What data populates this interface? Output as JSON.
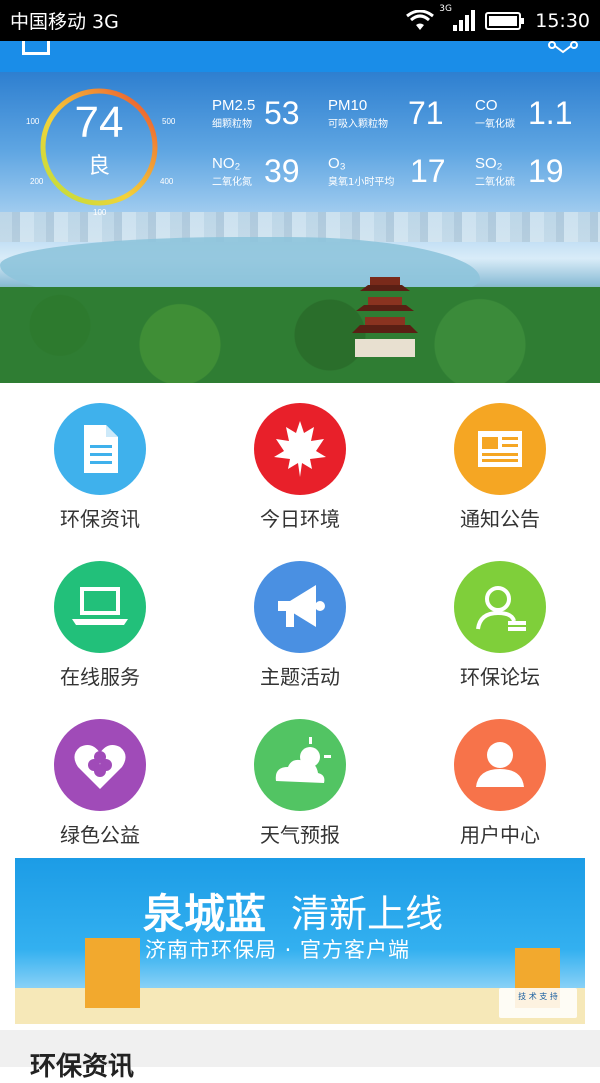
{
  "status_bar": {
    "carrier": "中国移动 3G",
    "network": "3G",
    "time": "15:30"
  },
  "air_quality": {
    "aqi": "74",
    "level": "良",
    "ring_ticks": [
      "100",
      "200",
      "300",
      "400",
      "500",
      "100"
    ],
    "pollutants": [
      {
        "name": "PM2.5",
        "desc": "细颗粒物",
        "value": "53"
      },
      {
        "name": "PM10",
        "desc": "可吸入颗粒物",
        "value": "71"
      },
      {
        "name": "CO",
        "desc": "一氧化碳",
        "value": "1.1"
      },
      {
        "name": "NO₂",
        "desc": "二氧化氮",
        "value": "39"
      },
      {
        "name": "O₃",
        "desc": "臭氧1小时平均",
        "value": "17"
      },
      {
        "name": "SO₂",
        "desc": "二氧化硫",
        "value": "19"
      }
    ]
  },
  "grid": [
    {
      "label": "环保资讯",
      "color": "#3fb1ec",
      "icon": "document-icon"
    },
    {
      "label": "今日环境",
      "color": "#e8202a",
      "icon": "maple-leaf-icon"
    },
    {
      "label": "通知公告",
      "color": "#f5a623",
      "icon": "newspaper-icon"
    },
    {
      "label": "在线服务",
      "color": "#22c07a",
      "icon": "laptop-icon"
    },
    {
      "label": "主题活动",
      "color": "#4a90e2",
      "icon": "megaphone-icon"
    },
    {
      "label": "环保论坛",
      "color": "#7fcf3a",
      "icon": "user-speech-icon"
    },
    {
      "label": "绿色公益",
      "color": "#a04bb8",
      "icon": "heart-clover-icon"
    },
    {
      "label": "天气预报",
      "color": "#52c463",
      "icon": "weather-icon"
    },
    {
      "label": "用户中心",
      "color": "#f7734a",
      "icon": "user-icon"
    }
  ],
  "banner": {
    "title": "泉城蓝",
    "subtitle": "清新上线",
    "line3": "济南市环保局 · 官方客户端",
    "badge": "技 术 支 持"
  },
  "bottom": {
    "section_title": "环保资讯"
  }
}
